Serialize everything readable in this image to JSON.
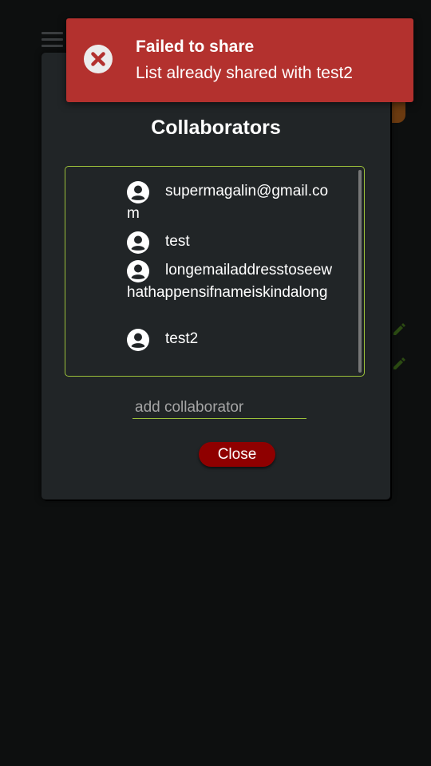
{
  "toast": {
    "title": "Failed to share",
    "message": "List already shared with test2",
    "icon": "error-x-icon",
    "color": "#b3312e"
  },
  "modal": {
    "title": "Collaborators",
    "collaborators": [
      {
        "name": "supermagalin@gmail.com",
        "icon": "user-circle-icon"
      },
      {
        "name": "test",
        "icon": "user-circle-icon"
      },
      {
        "name": "longemailaddresstoseewhathappensifnameiskindalong",
        "icon": "user-circle-icon"
      },
      {
        "name": "test2",
        "icon": "user-circle-icon"
      }
    ],
    "add_placeholder": "add collaborator",
    "add_value": "",
    "close_label": "Close",
    "accent_color": "#9bc03a",
    "close_color": "#8f0000"
  }
}
